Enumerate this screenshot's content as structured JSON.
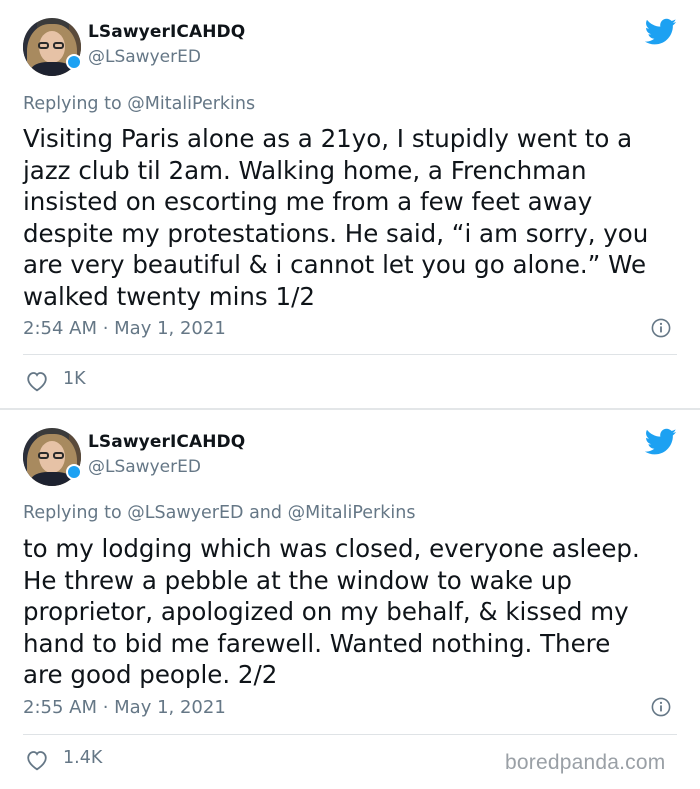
{
  "colors": {
    "twitter_blue": "#1da1f2",
    "secondary_text": "#657786",
    "primary_text": "#0f1419",
    "watermark": "#9aa0a6"
  },
  "tweets": [
    {
      "display_name": "LSawyerICAHDQ",
      "handle": "@LSawyerED",
      "replying_prefix": "Replying to",
      "replying_to": "@MitaliPerkins",
      "body_lines": [
        "Visiting Paris alone as a 21yo, I stupidly went to a",
        "jazz club til 2am. Walking home, a Frenchman",
        "insisted on escorting me from a few feet away",
        "despite my protestations. He said, “i am sorry, you",
        "are very beautiful & i cannot let you go alone.” We",
        "walked twenty mins 1/2"
      ],
      "timestamp": "2:54 AM · May 1, 2021",
      "likes": "1K",
      "icons": {
        "avatar": "avatar-icon",
        "platform": "twitter-bird-icon",
        "info": "info-icon",
        "like": "heart-icon"
      }
    },
    {
      "display_name": "LSawyerICAHDQ",
      "handle": "@LSawyerED",
      "replying_prefix": "Replying to",
      "replying_to_1": "@LSawyerED",
      "replying_and": "and",
      "replying_to_2": "@MitaliPerkins",
      "body_lines": [
        "to my lodging which was closed, everyone asleep.",
        "He threw a pebble at the window to wake up",
        "proprietor, apologized on my behalf, & kissed my",
        "hand to bid me farewell. Wanted nothing. There",
        "are good people. 2/2"
      ],
      "timestamp": "2:55 AM · May 1, 2021",
      "likes": "1.4K",
      "icons": {
        "avatar": "avatar-icon",
        "platform": "twitter-bird-icon",
        "info": "info-icon",
        "like": "heart-icon"
      }
    }
  ],
  "watermark": "boredpanda.com"
}
